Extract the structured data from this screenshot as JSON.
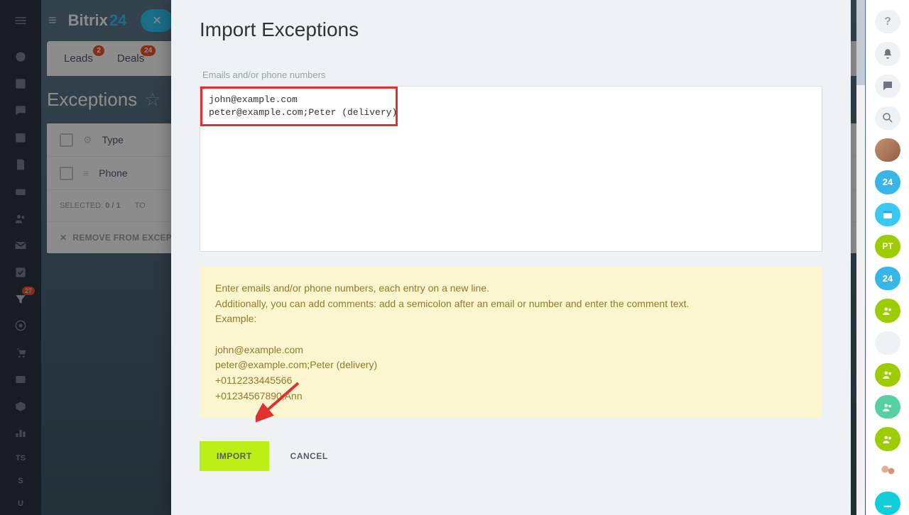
{
  "brand": {
    "name": "Bitrix",
    "suffix": "24"
  },
  "tabs": {
    "leads": {
      "label": "Leads",
      "badge": "2"
    },
    "deals": {
      "label": "Deals",
      "badge": "24"
    }
  },
  "page_title": "Exceptions",
  "left_rail_badge": "27",
  "left_rail_txt": {
    "ts": "TS",
    "s": "S",
    "u": "U"
  },
  "table": {
    "cols": {
      "type": "Type",
      "phone": "Phone"
    },
    "selected_label": "SELECTED:",
    "selected_value": "0 / 1",
    "total_label": "TO",
    "remove_label": "REMOVE FROM EXCEPTI"
  },
  "modal": {
    "title": "Import Exceptions",
    "field_label": "Emails and/or phone numbers",
    "textarea_value": "john@example.com\npeter@example.com;Peter (delivery)",
    "help_line1": "Enter emails and/or phone numbers, each entry on a new line.",
    "help_line2": "Additionally, you can add comments: add a semicolon after an email or number and enter the comment text.",
    "help_line3": "Example:",
    "help_ex1": "john@example.com",
    "help_ex2": "peter@example.com;Peter (delivery)",
    "help_ex3": "+0112233445566",
    "help_ex4": "+01234567890;Ann",
    "import_btn": "IMPORT",
    "cancel_btn": "CANCEL"
  },
  "right_rail": {
    "b24": "24",
    "pt": "PT"
  }
}
